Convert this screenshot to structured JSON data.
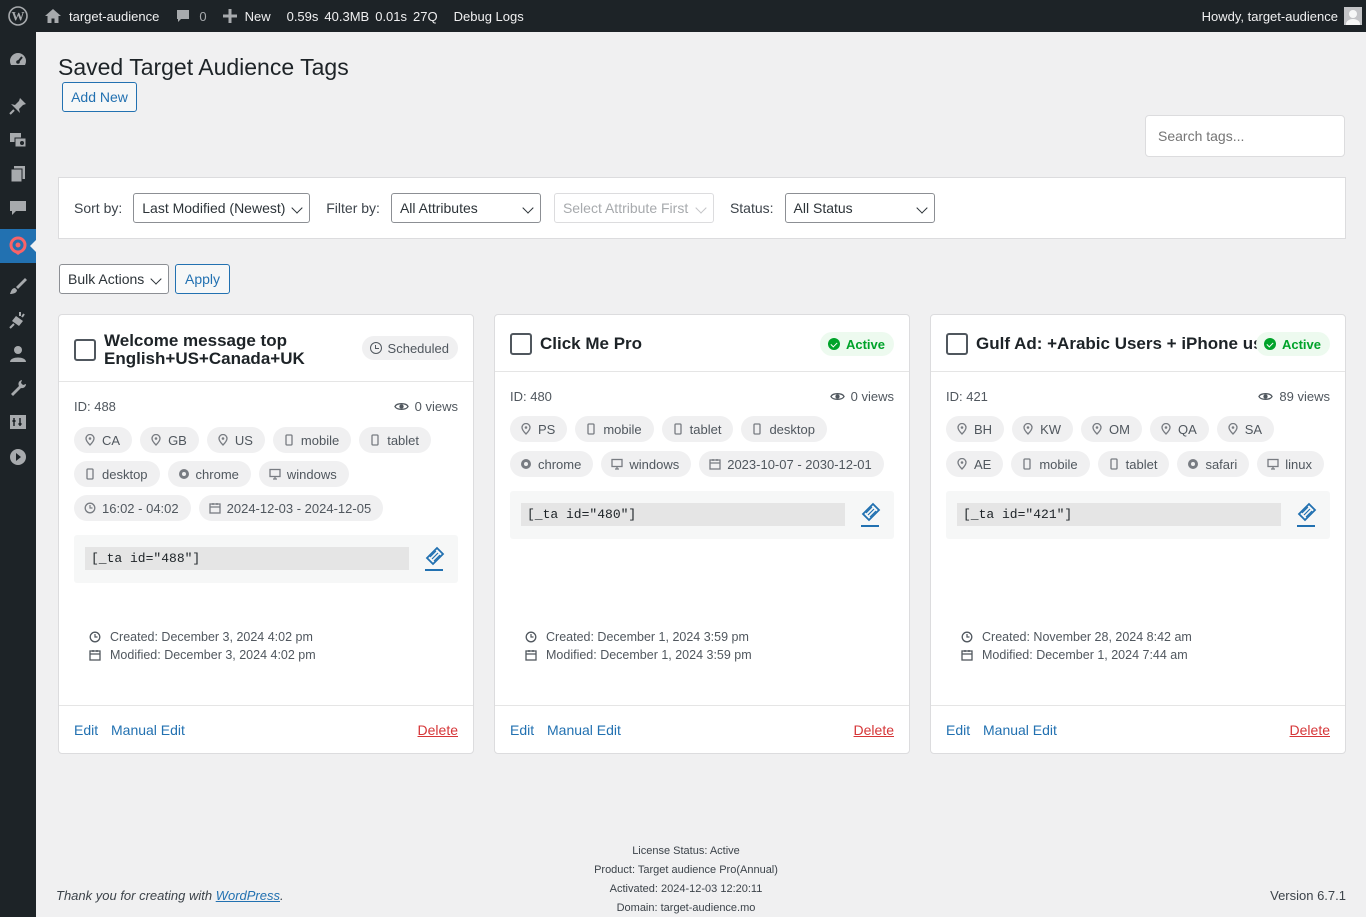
{
  "adminbar": {
    "site_name": "target-audience",
    "comments_count": "0",
    "new_label": "New",
    "stat_time": "0.59s",
    "stat_memory": "40.3MB",
    "stat_query_time": "0.01s",
    "stat_queries": "27Q",
    "debug_logs": "Debug Logs",
    "howdy": "Howdy, target-audience"
  },
  "page": {
    "title": "Saved Target Audience Tags",
    "add_new": "Add New",
    "search_placeholder": "Search tags..."
  },
  "filters": {
    "sort_label": "Sort by:",
    "sort_value": "Last Modified (Newest)",
    "filter_label": "Filter by:",
    "filter_value": "All Attributes",
    "attribute_value": "Select Attribute First",
    "status_label": "Status:",
    "status_value": "All Status"
  },
  "bulk": {
    "actions": "Bulk Actions",
    "apply": "Apply"
  },
  "cards": [
    {
      "title_line1": "Welcome message top",
      "title_line2": "English+US+Canada+UK",
      "status": "Scheduled",
      "id": "ID: 488",
      "views": "0 views",
      "chips": [
        "CA",
        "GB",
        "US",
        "mobile",
        "tablet",
        "desktop",
        "chrome",
        "windows",
        "16:02 - 04:02",
        "2024-12-03 - 2024-12-05"
      ],
      "shortcode": "[_ta id=\"488\"]",
      "created": "Created: December 3, 2024 4:02 pm",
      "modified": "Modified: December 3, 2024 4:02 pm",
      "edit": "Edit",
      "manual_edit": "Manual Edit",
      "delete": "Delete"
    },
    {
      "title_line1": "Click Me Pro",
      "status": "Active",
      "id": "ID: 480",
      "views": "0 views",
      "chips": [
        "PS",
        "mobile",
        "tablet",
        "desktop",
        "chrome",
        "windows",
        "2023-10-07 - 2030-12-01"
      ],
      "shortcode": "[_ta id=\"480\"]",
      "created": "Created: December 1, 2024 3:59 pm",
      "modified": "Modified: December 1, 2024 3:59 pm",
      "edit": "Edit",
      "manual_edit": "Manual Edit",
      "delete": "Delete"
    },
    {
      "title_line1": "Gulf Ad: +Arabic Users + iPhone user",
      "status": "Active",
      "id": "ID: 421",
      "views": "89 views",
      "chips": [
        "BH",
        "KW",
        "OM",
        "QA",
        "SA",
        "AE",
        "mobile",
        "tablet",
        "safari",
        "linux"
      ],
      "shortcode": "[_ta id=\"421\"]",
      "created": "Created: November 28, 2024 8:42 am",
      "modified": "Modified: December 1, 2024 7:44 am",
      "edit": "Edit",
      "manual_edit": "Manual Edit",
      "delete": "Delete"
    }
  ],
  "footer": {
    "thanks": "Thank you for creating with",
    "wordpress": "WordPress",
    "version": "Version 6.7.1",
    "license_status": "License Status: Active",
    "product": "Product: Target audience Pro(Annual)",
    "activated": "Activated: 2024-12-03 12:20:11",
    "domain": "Domain: target-audience.mo"
  }
}
